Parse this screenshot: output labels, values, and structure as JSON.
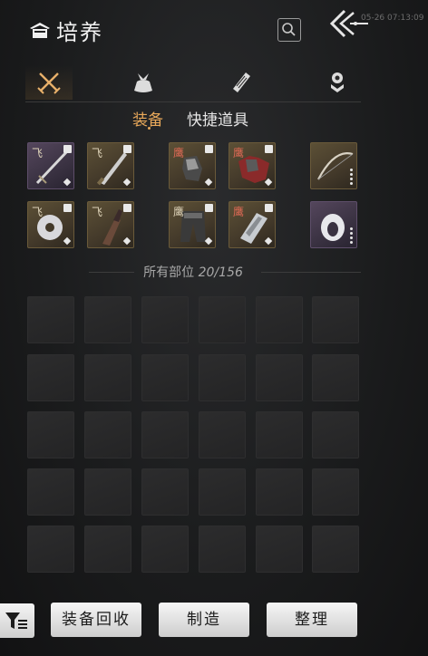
{
  "header": {
    "title": "培养",
    "ghost_timestamp": "05-26 07:13:09"
  },
  "icons": {
    "title": "tile-roof-icon",
    "search": "search-icon",
    "back": "double-chevron-left-icon",
    "categories": [
      "crossed-swords-icon",
      "pouch-icon",
      "scroll-icon",
      "pendant-icon"
    ]
  },
  "category_tabs": [
    {
      "name": "weapons",
      "active": true
    },
    {
      "name": "consumables",
      "active": false
    },
    {
      "name": "scrolls",
      "active": false
    },
    {
      "name": "accessories",
      "active": false
    }
  ],
  "sub_tabs": [
    {
      "label": "装备",
      "active": true
    },
    {
      "label": "快捷道具",
      "active": false
    }
  ],
  "equipped": [
    {
      "mark": "飞",
      "rarity": "purple",
      "item": "sword-icon"
    },
    {
      "mark": "飞",
      "rarity": "gold",
      "item": "blade-icon"
    },
    {
      "mark": "鹰",
      "rarity": "gold",
      "item": "gauntlet-icon"
    },
    {
      "mark": "鹰",
      "rarity": "gold",
      "item": "armor-icon"
    },
    {
      "mark": "",
      "rarity": "gold",
      "item": "bow-icon"
    },
    {
      "mark": "飞",
      "rarity": "gold",
      "item": "jade-disc-icon"
    },
    {
      "mark": "飞",
      "rarity": "gold",
      "item": "dagger-icon"
    },
    {
      "mark": "鹰",
      "rarity": "gold",
      "item": "leggings-icon"
    },
    {
      "mark": "鹰",
      "rarity": "gold",
      "item": "bracer-icon"
    },
    {
      "mark": "",
      "rarity": "purple",
      "item": "ring-icon"
    }
  ],
  "inventory": {
    "label": "所有部位",
    "count": "20/156",
    "empty_slots": 30
  },
  "footer": {
    "filter_icon": "filter-list-icon",
    "buttons": [
      "装备回收",
      "制造",
      "整理"
    ]
  },
  "colors": {
    "accent": "#e8a85a",
    "gold_slot": "#5c5036",
    "purple_slot": "#54465c",
    "background": "#1a1b1c"
  }
}
